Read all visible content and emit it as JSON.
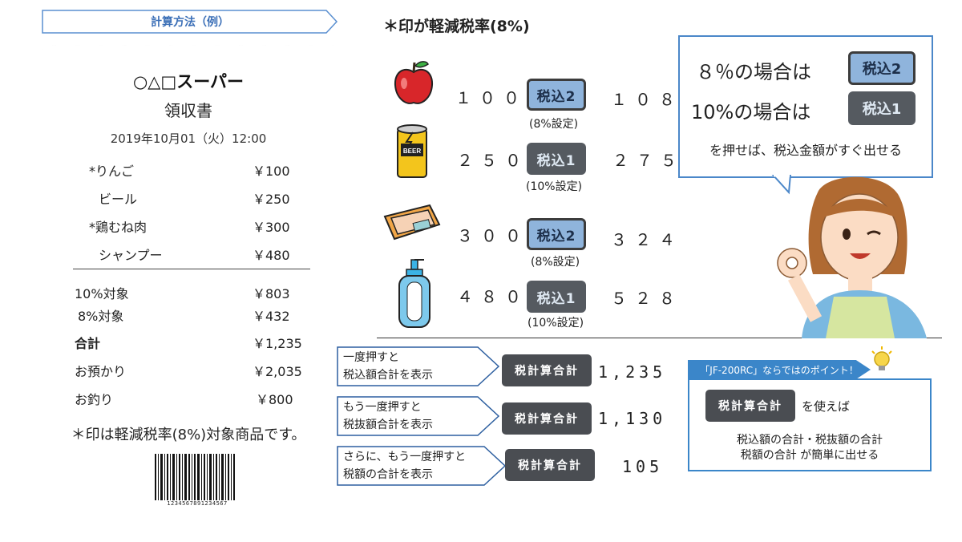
{
  "title_banner": "計算方法（例）",
  "receipt": {
    "store": "○△□スーパー",
    "doc_title": "領収書",
    "datetime": "2019年10月01（火）12:00",
    "items": [
      {
        "name": "*りんご",
        "price": "￥100"
      },
      {
        "name": "ビール",
        "price": "￥250"
      },
      {
        "name": "*鶏むね肉",
        "price": "￥300"
      },
      {
        "name": "シャンプー",
        "price": "￥480"
      }
    ],
    "subtotals": [
      {
        "name": "10%対象",
        "price": "￥803"
      },
      {
        "name": "8%対象",
        "price": "￥432"
      }
    ],
    "total": {
      "name": "合計",
      "price": "￥1,235"
    },
    "paid": {
      "name": "お預かり",
      "price": "￥2,035"
    },
    "change": {
      "name": "お釣り",
      "price": "￥800"
    },
    "note": "＊印は軽減税率(8%)対象商品です。",
    "barcode_number": "1234567891234567"
  },
  "reduced_title": "＊印が軽減税率(8%)",
  "rows": [
    {
      "icon": "apple-icon",
      "price": "１００",
      "button": "税込2",
      "setting": "(8%設定)",
      "result": "１０８"
    },
    {
      "icon": "beer-can-icon",
      "price": "２５０",
      "button": "税込1",
      "setting": "(10%設定)",
      "result": "２７５"
    },
    {
      "icon": "chicken-meat-icon",
      "price": "３００",
      "button": "税込2",
      "setting": "(8%設定)",
      "result": "３２４"
    },
    {
      "icon": "shampoo-bottle-icon",
      "price": "４８０",
      "button": "税込1",
      "setting": "(10%設定)",
      "result": "５２８"
    }
  ],
  "bubble": {
    "line1": "８％の場合は",
    "line2": "10%の場合は",
    "btn2": "税込2",
    "btn1": "税込1",
    "hint": "を押せば、税込金額がすぐ出せる"
  },
  "actions": [
    {
      "text1": "一度押すと",
      "text2": "税込額合計を表示",
      "button": "税計算合計",
      "result": "1,235"
    },
    {
      "text1": "もう一度押すと",
      "text2": "税抜額合計を表示",
      "button": "税計算合計",
      "result": "1,130"
    },
    {
      "text1": "さらに、もう一度押すと",
      "text2": "税額の合計を表示",
      "button": "税計算合計",
      "result": "105"
    }
  ],
  "point": {
    "tab": "「JF-200RC」ならではのポイント！",
    "button": "税計算合計",
    "use_text": "を使えば",
    "desc1": "税込額の合計・税抜額の合計",
    "desc2": "税額の合計 が簡単に出せる"
  },
  "colors": {
    "accent_blue": "#3b86c9",
    "button_light": "#8fb4dc",
    "button_dark": "#555a60"
  }
}
